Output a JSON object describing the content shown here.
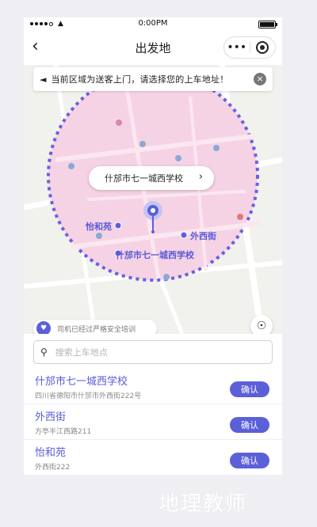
{
  "status_bar": {
    "time": "0:00PM",
    "battery_percent": 100
  },
  "nav": {
    "title": "出发地",
    "more": "•••"
  },
  "notice": {
    "text": "当前区域为送客上门，请选择您的上车地址！"
  },
  "map": {
    "popup": {
      "name": "什邡市七一城西学校"
    },
    "labels": {
      "yihe": "怡和苑",
      "waixi": "外西街",
      "school": "什邡市七一城西学校"
    },
    "safety": "司机已经过严格安全培训",
    "colors": {
      "zone_fill": "#f6d3e4",
      "zone_border": "#6b5fe0",
      "pin": "#5b5fd8"
    }
  },
  "search": {
    "placeholder": "搜索上车地点"
  },
  "places": [
    {
      "name": "什邡市七一城西学校",
      "address": "四川省德阳市什邡市外西街222号",
      "confirm": "确认"
    },
    {
      "name": "外西街",
      "address": "方亭半江西路211",
      "confirm": "确认"
    },
    {
      "name": "怡和苑",
      "address": "外西街222",
      "confirm": "确认"
    }
  ],
  "watermark": "地理教师"
}
